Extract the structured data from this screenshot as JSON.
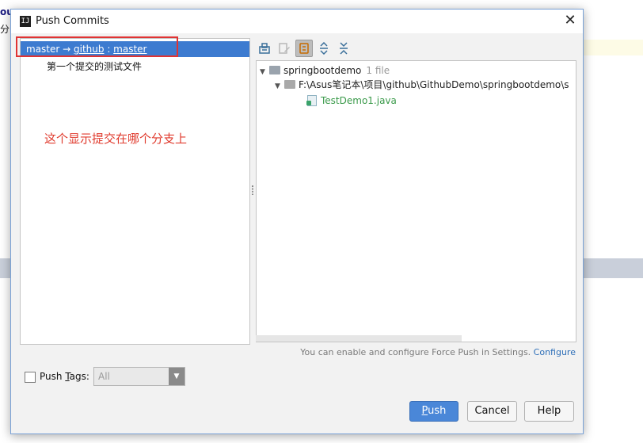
{
  "background": {
    "top_text": "ou",
    "top_text2": "分"
  },
  "dialog": {
    "title": "Push Commits",
    "close_glyph": "✕"
  },
  "left": {
    "branch": {
      "local": "master",
      "arrow": " → ",
      "remote": "github",
      "sep": " : ",
      "remote_branch": "master"
    },
    "commit_message": "第一个提交的测试文件",
    "annotation": "这个显示提交在哪个分支上"
  },
  "toolbar": {
    "icons": [
      "group-by-module-icon",
      "edit-source-icon",
      "show-diff-icon",
      "expand-all-icon",
      "collapse-all-icon"
    ]
  },
  "tree": {
    "module": "springbootdemo",
    "module_count": "1 file",
    "path": "F:\\Asus笔记本\\项目\\github\\GithubDemo\\springbootdemo\\s",
    "file": "TestDemo1.java"
  },
  "hint": {
    "text": "You can enable and configure Force Push in Settings.",
    "link": "Configure"
  },
  "push_tags": {
    "label_pre": "Push ",
    "label_mnemonic": "T",
    "label_post": "ags:",
    "selected": "All"
  },
  "buttons": {
    "push_mnemonic": "P",
    "push_rest": "ush",
    "cancel": "Cancel",
    "help": "Help"
  },
  "colors": {
    "selection": "#3d7bd0",
    "annotation": "#e03b2e",
    "push_button": "#4a87d8",
    "java_file": "#3a9a4a"
  }
}
